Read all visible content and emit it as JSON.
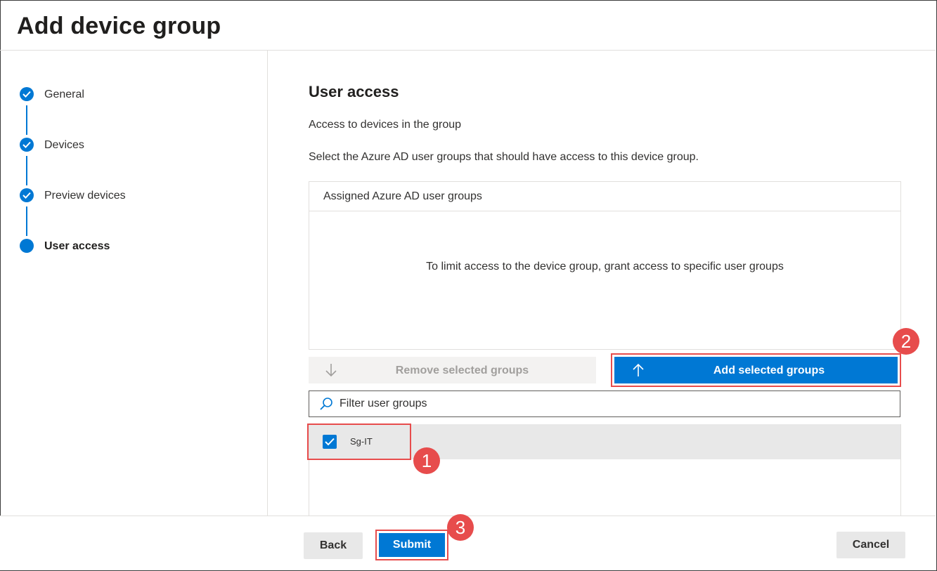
{
  "header": {
    "title": "Add device group"
  },
  "steps": [
    {
      "label": "General",
      "state": "completed"
    },
    {
      "label": "Devices",
      "state": "completed"
    },
    {
      "label": "Preview devices",
      "state": "completed"
    },
    {
      "label": "User access",
      "state": "current"
    }
  ],
  "main": {
    "section_title": "User access",
    "description_1": "Access to devices in the group",
    "description_2": "Select the Azure AD user groups that should have access to this device group.",
    "assigned": {
      "title": "Assigned Azure AD user groups",
      "empty_message": "To limit access to the device group, grant access to specific user groups"
    },
    "remove_button": "Remove selected groups",
    "add_button": "Add selected groups",
    "filter": {
      "placeholder": "Filter user groups",
      "value": ""
    },
    "groups": [
      {
        "name": "Sg-IT",
        "checked": true
      }
    ]
  },
  "footer": {
    "back": "Back",
    "submit": "Submit",
    "cancel": "Cancel"
  },
  "annotations": [
    "1",
    "2",
    "3"
  ],
  "colors": {
    "accent": "#0078d4",
    "highlight": "#e74c4c",
    "disabled_bg": "#f3f2f1"
  }
}
